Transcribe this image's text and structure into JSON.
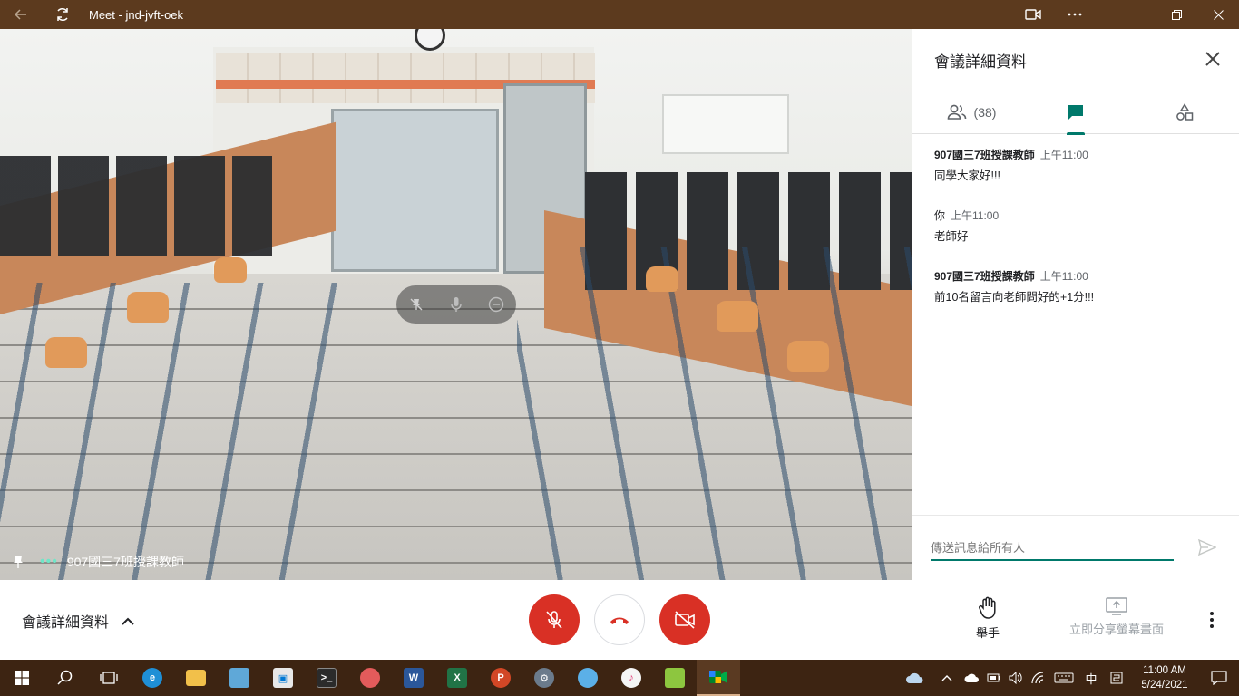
{
  "window": {
    "title": "Meet - jnd-jvft-oek"
  },
  "video": {
    "participant_name": "907國三7班授課教師"
  },
  "panel": {
    "title": "會議詳細資料",
    "people_count": "(38)",
    "messages": [
      {
        "sender": "907國三7班授課教師",
        "time": "上午11:00",
        "text": "同學大家好!!!"
      },
      {
        "sender": "你",
        "time": "上午11:00",
        "text": "老師好"
      },
      {
        "sender": "907國三7班授課教師",
        "time": "上午11:00",
        "text": "前10名留言向老師問好的+1分!!!"
      }
    ],
    "composer_placeholder": "傳送訊息給所有人"
  },
  "bottom": {
    "details_label": "會議詳細資料",
    "raise_hand_label": "舉手",
    "share_label": "立即分享螢幕畫面"
  },
  "taskbar": {
    "ime": "中",
    "time": "11:00 AM",
    "date": "5/24/2021"
  },
  "colors": {
    "titlebar": "#5c3a1e",
    "taskbar": "#3d2412",
    "accent": "#00796b",
    "danger": "#d93025"
  }
}
